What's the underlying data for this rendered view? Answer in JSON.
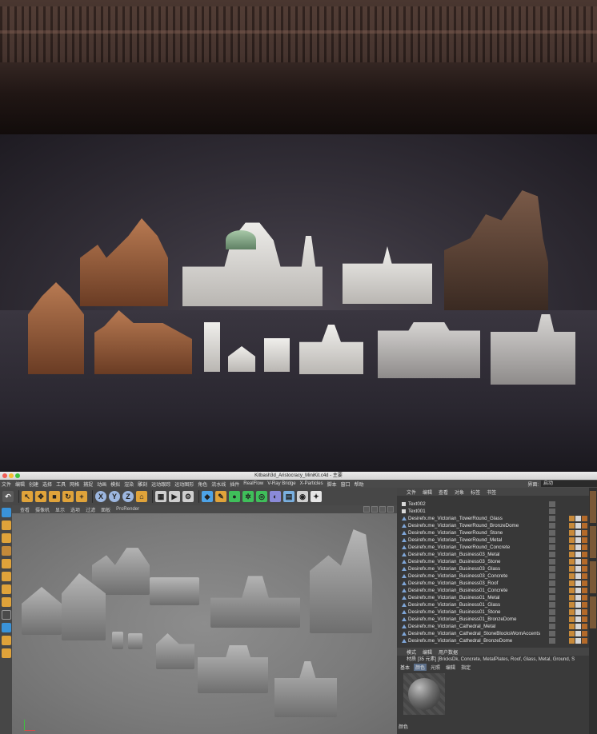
{
  "window": {
    "title": "Kitbash3d_Aristocracy_MiniKit.c4d - 主要"
  },
  "menubar": {
    "items": [
      "文件",
      "编辑",
      "创建",
      "选择",
      "工具",
      "网格",
      "捕捉",
      "动画",
      "模拟",
      "渲染",
      "雕刻",
      "运动跟踪",
      "运动图形",
      "角色",
      "流水线",
      "插件",
      "RealFlow",
      "V-Ray Bridge",
      "X-Particles",
      "脚本",
      "窗口",
      "帮助"
    ],
    "layout_label": "界面:",
    "layout_value": "启动"
  },
  "toolbar": {
    "axis_x": "X",
    "axis_y": "Y",
    "axis_z": "Z"
  },
  "viewport": {
    "menu": [
      "查看",
      "摄像机",
      "显示",
      "选项",
      "过滤",
      "面板",
      "ProRender"
    ]
  },
  "object_manager": {
    "menu": [
      "文件",
      "编辑",
      "查看",
      "对象",
      "标签",
      "书签"
    ],
    "objects": [
      {
        "name": "Text002",
        "type": "text"
      },
      {
        "name": "Text001",
        "type": "text"
      },
      {
        "name": "Desirefx.me_Victorian_TowerRound_Glass",
        "type": "mesh"
      },
      {
        "name": "Desirefx.me_Victorian_TowerRound_BronzeDome",
        "type": "mesh"
      },
      {
        "name": "Desirefx.me_Victorian_TowerRound_Stone",
        "type": "mesh"
      },
      {
        "name": "Desirefx.me_Victorian_TowerRound_Metal",
        "type": "mesh"
      },
      {
        "name": "Desirefx.me_Victorian_TowerRound_Concrete",
        "type": "mesh"
      },
      {
        "name": "Desirefx.me_Victorian_Business03_Metal",
        "type": "mesh"
      },
      {
        "name": "Desirefx.me_Victorian_Business03_Stone",
        "type": "mesh"
      },
      {
        "name": "Desirefx.me_Victorian_Business03_Glass",
        "type": "mesh"
      },
      {
        "name": "Desirefx.me_Victorian_Business03_Concrete",
        "type": "mesh"
      },
      {
        "name": "Desirefx.me_Victorian_Business03_Roof",
        "type": "mesh"
      },
      {
        "name": "Desirefx.me_Victorian_Business01_Concrete",
        "type": "mesh"
      },
      {
        "name": "Desirefx.me_Victorian_Business01_Metal",
        "type": "mesh"
      },
      {
        "name": "Desirefx.me_Victorian_Business01_Glass",
        "type": "mesh"
      },
      {
        "name": "Desirefx.me_Victorian_Business01_Stone",
        "type": "mesh"
      },
      {
        "name": "Desirefx.me_Victorian_Business01_BronzeDome",
        "type": "mesh"
      },
      {
        "name": "Desirefx.me_Victorian_Cathedral_Metal",
        "type": "mesh"
      },
      {
        "name": "Desirefx.me_Victorian_Cathedral_StoneBlocksWornAccents",
        "type": "mesh"
      },
      {
        "name": "Desirefx.me_Victorian_Cathedral_BronzeDome",
        "type": "mesh"
      }
    ]
  },
  "attributes": {
    "tabs": [
      "模式",
      "编辑",
      "用户数据"
    ],
    "info": "材质 [35 元素] [BricksDk, Concrete, MetalPlates, Roof, Glass, Metal, Ground, S",
    "subtabs": [
      "基本",
      "颜色",
      "光照",
      "编辑",
      "指定"
    ],
    "active_subtab": "颜色",
    "color_label": "颜色"
  }
}
